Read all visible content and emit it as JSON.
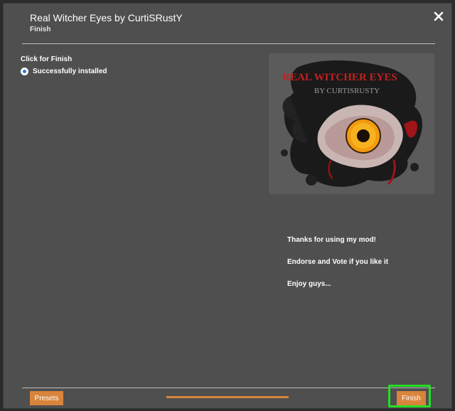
{
  "window": {
    "title": "Real Witcher Eyes by CurtiSRustY",
    "subtitle": "Finish"
  },
  "step": {
    "group_label": "Click for Finish",
    "option_label": "Successfully installed"
  },
  "preview": {
    "image_text_title": "REAL WITCHER EYES",
    "image_text_by": "BY CURTISRUSTY"
  },
  "description": {
    "line1": "Thanks for using my mod!",
    "line2": "Endorse and Vote if you like it",
    "line3": "Enjoy guys..."
  },
  "footer": {
    "presets_label": "Presets",
    "finish_label": "Finish"
  },
  "colors": {
    "accent": "#d8843c",
    "highlight": "#22e022",
    "dialog_bg": "#4f4f4f"
  }
}
